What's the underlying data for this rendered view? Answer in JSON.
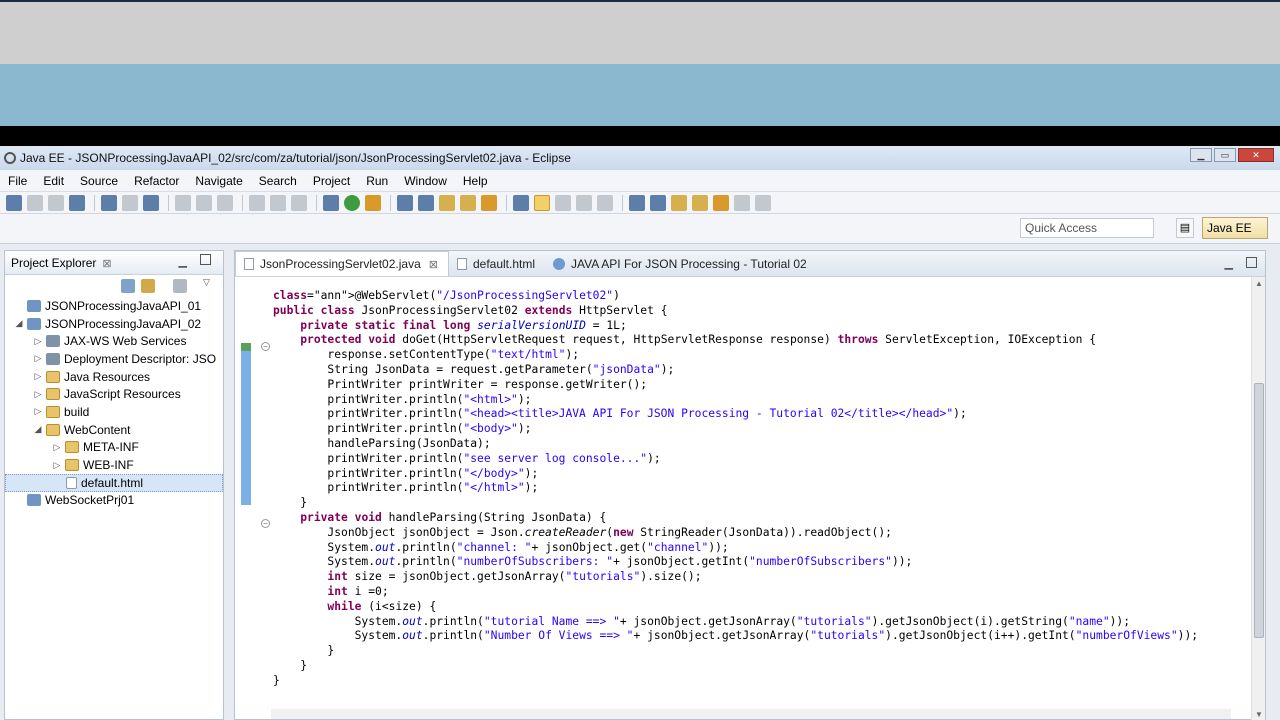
{
  "window": {
    "title": "Java EE - JSONProcessingJavaAPI_02/src/com/za/tutorial/json/JsonProcessingServlet02.java - Eclipse"
  },
  "menu": [
    "File",
    "Edit",
    "Source",
    "Refactor",
    "Navigate",
    "Search",
    "Project",
    "Run",
    "Window",
    "Help"
  ],
  "quick_access": {
    "placeholder": "Quick Access"
  },
  "perspective": {
    "label": "Java EE"
  },
  "project_explorer": {
    "title": "Project Explorer",
    "close_glyph": "⊠",
    "tree": [
      {
        "label": "JSONProcessingJavaAPI_01",
        "level": 0,
        "twisty": "",
        "icon": "project-icon"
      },
      {
        "label": "JSONProcessingJavaAPI_02",
        "level": 0,
        "twisty": "◢",
        "icon": "project-icon"
      },
      {
        "label": "JAX-WS Web Services",
        "level": 1,
        "twisty": "▷",
        "icon": "package-icon"
      },
      {
        "label": "Deployment Descriptor: JSO",
        "level": 1,
        "twisty": "▷",
        "icon": "package-icon"
      },
      {
        "label": "Java Resources",
        "level": 1,
        "twisty": "▷",
        "icon": "folder-icon"
      },
      {
        "label": "JavaScript Resources",
        "level": 1,
        "twisty": "▷",
        "icon": "folder-icon"
      },
      {
        "label": "build",
        "level": 1,
        "twisty": "▷",
        "icon": "folder-icon"
      },
      {
        "label": "WebContent",
        "level": 1,
        "twisty": "◢",
        "icon": "folder-icon"
      },
      {
        "label": "META-INF",
        "level": 2,
        "twisty": "▷",
        "icon": "folder-icon"
      },
      {
        "label": "WEB-INF",
        "level": 2,
        "twisty": "▷",
        "icon": "folder-icon"
      },
      {
        "label": "default.html",
        "level": 2,
        "twisty": "",
        "icon": "file-icon",
        "selected": true
      },
      {
        "label": "WebSocketPrj01",
        "level": 0,
        "twisty": "",
        "icon": "project-icon"
      }
    ]
  },
  "editor": {
    "tabs": [
      {
        "label": "JsonProcessingServlet02.java",
        "active": true,
        "close": "⊠"
      },
      {
        "label": "default.html",
        "active": false,
        "close": ""
      },
      {
        "label": "JAVA API For JSON Processing - Tutorial 02",
        "active": false,
        "close": ""
      }
    ],
    "code_lines": [
      "@WebServlet(\"/JsonProcessingServlet02\")",
      "public class JsonProcessingServlet02 extends HttpServlet {",
      "    private static final long serialVersionUID = 1L;",
      "    protected void doGet(HttpServletRequest request, HttpServletResponse response) throws ServletException, IOException {",
      "        response.setContentType(\"text/html\");",
      "        String JsonData = request.getParameter(\"jsonData\");",
      "        PrintWriter printWriter = response.getWriter();",
      "        printWriter.println(\"<html>\");",
      "        printWriter.println(\"<head><title>JAVA API For JSON Processing - Tutorial 02</title></head>\");",
      "        printWriter.println(\"<body>\");",
      "        handleParsing(JsonData);",
      "        printWriter.println(\"see server log console...\");",
      "        printWriter.println(\"</body>\");",
      "        printWriter.println(\"</html>\");",
      "    }",
      "    private void handleParsing(String JsonData) {",
      "        JsonObject jsonObject = Json.createReader(new StringReader(JsonData)).readObject();",
      "        System.out.println(\"channel: \"+ jsonObject.get(\"channel\"));",
      "        System.out.println(\"numberOfSubscribers: \"+ jsonObject.getInt(\"numberOfSubscribers\"));",
      "        int size = jsonObject.getJsonArray(\"tutorials\").size();",
      "        int i =0;",
      "        while (i<size) {",
      "            System.out.println(\"tutorial Name ==> \"+ jsonObject.getJsonArray(\"tutorials\").getJsonObject(i).getString(\"name\"));",
      "            System.out.println(\"Number Of Views ==> \"+ jsonObject.getJsonArray(\"tutorials\").getJsonObject(i++).getInt(\"numberOfViews\"));",
      "        }",
      "    }",
      "}"
    ]
  },
  "colors": {
    "keyword": "#7f0055",
    "string": "#2a00ff",
    "annotation": "#646464",
    "static_field": "#0000c0"
  }
}
